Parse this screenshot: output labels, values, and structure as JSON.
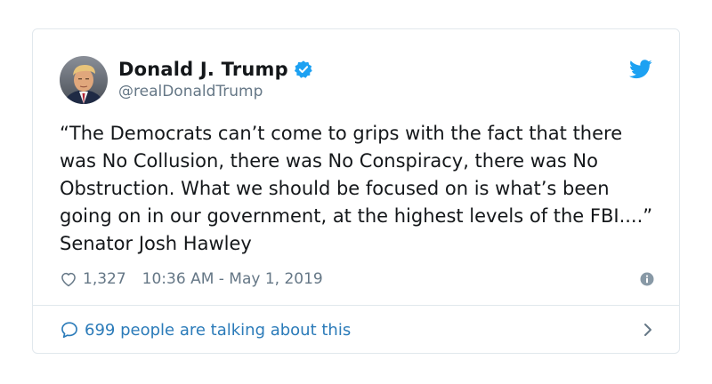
{
  "author": {
    "name": "Donald J. Trump",
    "handle": "@realDonaldTrump",
    "verified_icon": "verified-badge-icon",
    "avatar": "profile-photo"
  },
  "brand_icon": "twitter-bird-icon",
  "tweet": {
    "text": "“The Democrats can’t come to grips with the fact that there was No Collusion, there was No Conspiracy, there was No Obstruction. What we should be focused on is what’s been going on in our government, at the highest levels of the FBI....” Senator Josh Hawley"
  },
  "meta": {
    "likes": "1,327",
    "timestamp": "10:36 AM - May 1, 2019",
    "like_icon": "heart-icon",
    "info_icon": "info-icon"
  },
  "conversation": {
    "label": "699 people are talking about this",
    "icon": "speech-bubble-icon",
    "chevron": "chevron-right-icon"
  },
  "colors": {
    "twitter_blue": "#1da1f2",
    "link_blue": "#2b7bb9",
    "text": "#14171a",
    "secondary": "#657786",
    "border": "#e1e8ed"
  }
}
